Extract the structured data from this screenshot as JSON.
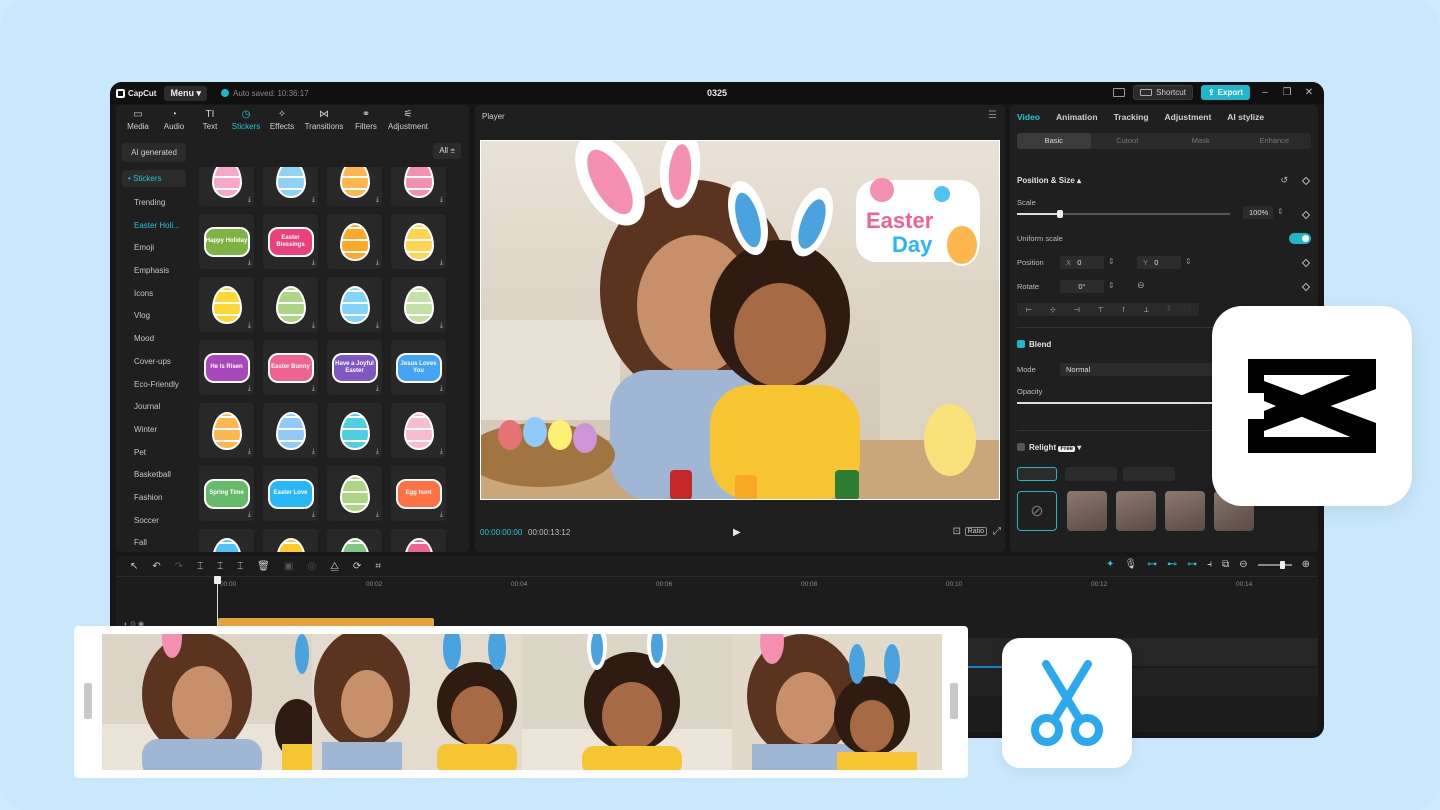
{
  "app": {
    "logo_text": "CapCut",
    "menu_label": "Menu",
    "autosave": "Auto saved: 10:36:17",
    "project_name": "0325",
    "shortcut_label": "Shortcut",
    "export_label": "Export",
    "accent_color": "#1fb6c9"
  },
  "toolbar": {
    "tabs": [
      {
        "label": "Media",
        "icon": "media-icon"
      },
      {
        "label": "Audio",
        "icon": "audio-icon"
      },
      {
        "label": "Text",
        "icon": "text-icon"
      },
      {
        "label": "Stickers",
        "icon": "stickers-icon",
        "active": true
      },
      {
        "label": "Effects",
        "icon": "effects-icon"
      },
      {
        "label": "Transitions",
        "icon": "transitions-icon"
      },
      {
        "label": "Filters",
        "icon": "filters-icon"
      },
      {
        "label": "Adjustment",
        "icon": "adjustment-icon"
      }
    ]
  },
  "stickers": {
    "ai_generated": "AI generated",
    "filter_label": "All",
    "categories": [
      "Stickers",
      "Trending",
      "Easter Holi...",
      "Emoji",
      "Emphasis",
      "Icons",
      "Vlog",
      "Mood",
      "Cover-ups",
      "Eco-Friendly",
      "Journal",
      "Winter",
      "Pet",
      "Basketball",
      "Fashion",
      "Soccer",
      "Fall"
    ],
    "items": [
      {
        "kind": "egg",
        "color": "#f7a8c8"
      },
      {
        "kind": "egg",
        "color": "#8fd3f4"
      },
      {
        "kind": "egg",
        "color": "#ffb74d"
      },
      {
        "kind": "egg",
        "color": "#f48fb1"
      },
      {
        "kind": "badge",
        "text": "Happy Holiday",
        "color": "#7cb342"
      },
      {
        "kind": "badge",
        "text": "Easter Blessings",
        "color": "#ec407a"
      },
      {
        "kind": "egg",
        "color": "#ffa726"
      },
      {
        "kind": "egg",
        "color": "#ffd54f"
      },
      {
        "kind": "egg",
        "color": "#fdd835"
      },
      {
        "kind": "egg",
        "color": "#aed581"
      },
      {
        "kind": "egg",
        "color": "#81d4fa"
      },
      {
        "kind": "egg",
        "color": "#c5e1a5"
      },
      {
        "kind": "badge",
        "text": "He Is Risen",
        "color": "#ab47bc"
      },
      {
        "kind": "badge",
        "text": "Easter Bunny",
        "color": "#f06292"
      },
      {
        "kind": "badge",
        "text": "Have a Joyful Easter",
        "color": "#7e57c2"
      },
      {
        "kind": "badge",
        "text": "Jesus Loves You",
        "color": "#42a5f5"
      },
      {
        "kind": "egg",
        "color": "#ffb74d"
      },
      {
        "kind": "egg",
        "color": "#90caf9"
      },
      {
        "kind": "egg",
        "color": "#4dd0e1"
      },
      {
        "kind": "egg",
        "color": "#f8bbd0"
      },
      {
        "kind": "badge",
        "text": "Spring Time",
        "color": "#66bb6a"
      },
      {
        "kind": "badge",
        "text": "Easter Love",
        "color": "#29b6f6"
      },
      {
        "kind": "egg",
        "color": "#aed581"
      },
      {
        "kind": "badge",
        "text": "Egg hunt",
        "color": "#ff7043"
      },
      {
        "kind": "egg",
        "color": "#4fc3f7"
      },
      {
        "kind": "egg",
        "color": "#ffca28"
      },
      {
        "kind": "egg",
        "color": "#81c784"
      },
      {
        "kind": "egg",
        "color": "#f06292"
      }
    ]
  },
  "player": {
    "title": "Player",
    "current_time": "00:00:00:00",
    "total_time": "00:00:13:12",
    "ratio_label": "Ratio",
    "sticker_text_line1": "Easter",
    "sticker_text_line2": "Day"
  },
  "inspector": {
    "tabs": [
      "Video",
      "Animation",
      "Tracking",
      "Adjustment",
      "AI stylize"
    ],
    "sub_tabs": [
      "Basic",
      "Cutout",
      "Mask",
      "Enhance"
    ],
    "position_size": "Position & Size",
    "scale_label": "Scale",
    "scale_value": "100%",
    "scale_fraction": 0.2,
    "uniform_scale": "Uniform scale",
    "position_label": "Position",
    "x_label": "X",
    "x_value": "0",
    "y_label": "Y",
    "y_value": "0",
    "rotate_label": "Rotate",
    "rotate_value": "0°",
    "blend_label": "Blend",
    "mode_label": "Mode",
    "mode_value": "Normal",
    "opacity_label": "Opacity",
    "relight_label": "Relight",
    "relight_badge": "Free"
  },
  "timeline": {
    "ticks": [
      "00:00",
      "00:02",
      "00:04",
      "00:06",
      "00:08",
      "00:10",
      "00:12",
      "00:14"
    ]
  }
}
